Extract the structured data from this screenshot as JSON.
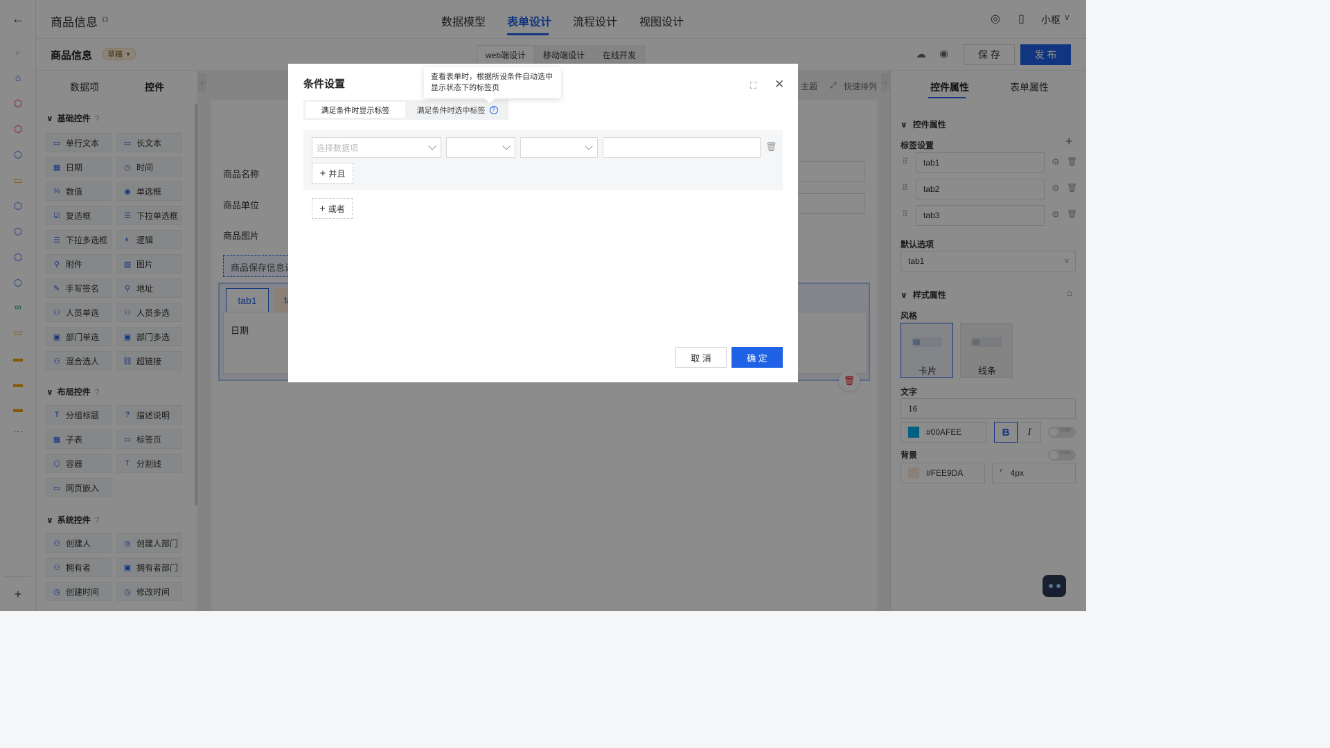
{
  "header": {
    "back_icon": "arrow-left-icon",
    "app_title": "商品信息",
    "nav_tabs": [
      "数据模型",
      "表单设计",
      "流程设计",
      "视图设计"
    ],
    "active_tab": "表单设计",
    "user_name": "小枢"
  },
  "subbar": {
    "form_title": "商品信息",
    "status_badge": "草稿",
    "modes": [
      "web端设计",
      "移动端设计",
      "在线开发"
    ],
    "save_label": "保 存",
    "publish_label": "发 布",
    "colors": {
      "publish_bg": "#1f62e6"
    }
  },
  "left_panel": {
    "tabs": [
      "数据项",
      "控件"
    ],
    "sections": [
      {
        "title": "基础控件",
        "items": [
          "单行文本",
          "长文本",
          "日期",
          "时间",
          "数值",
          "单选框",
          "复选框",
          "下拉单选框",
          "下拉多选框",
          "逻辑",
          "附件",
          "图片",
          "手写签名",
          "地址",
          "人员单选",
          "人员多选",
          "部门单选",
          "部门多选",
          "混合选人",
          "超链接"
        ]
      },
      {
        "title": "布局控件",
        "items": [
          "分组标题",
          "描述说明",
          "子表",
          "标签页",
          "容器",
          "分割线",
          "网页嵌入"
        ]
      },
      {
        "title": "系统控件",
        "items": [
          "创建人",
          "创建人部门",
          "拥有者",
          "拥有者部门",
          "创建时间",
          "修改时间"
        ]
      }
    ]
  },
  "canvas": {
    "toolbar": [
      "主题",
      "快速排列"
    ],
    "fields": [
      "商品名称",
      "商品单位",
      "商品图片"
    ],
    "notice": "商品保存信息设",
    "tabs": [
      "tab1",
      "ta"
    ],
    "tab_field": "日期"
  },
  "right_panel": {
    "tabs": [
      "控件属性",
      "表单属性"
    ],
    "section_control": "控件属性",
    "label_settings": "标签设置",
    "tab_items": [
      "tab1",
      "tab2",
      "tab3"
    ],
    "default_label": "默认选项",
    "default_value": "tab1",
    "section_style": "样式属性",
    "style_label": "风格",
    "style_options": [
      "卡片",
      "线条"
    ],
    "text_label": "文字",
    "font_size": "16",
    "text_color": "#00AFEE",
    "bold": "B",
    "italic": "I",
    "css_toggle": "CSS",
    "bg_label": "背景",
    "bg_color": "#FEE9DA",
    "radius": "4px"
  },
  "modal": {
    "title": "条件设置",
    "tabs": [
      "满足条件时显示标签",
      "满足条件时选中标签"
    ],
    "tooltip": "查看表单时，根据所设条件自动选中显示状态下的标签页",
    "field_placeholder": "选择数据项",
    "and_label": "并且",
    "or_label": "或者",
    "cancel_label": "取 消",
    "ok_label": "确 定",
    "colors": {
      "primary": "#1f62e6"
    }
  }
}
